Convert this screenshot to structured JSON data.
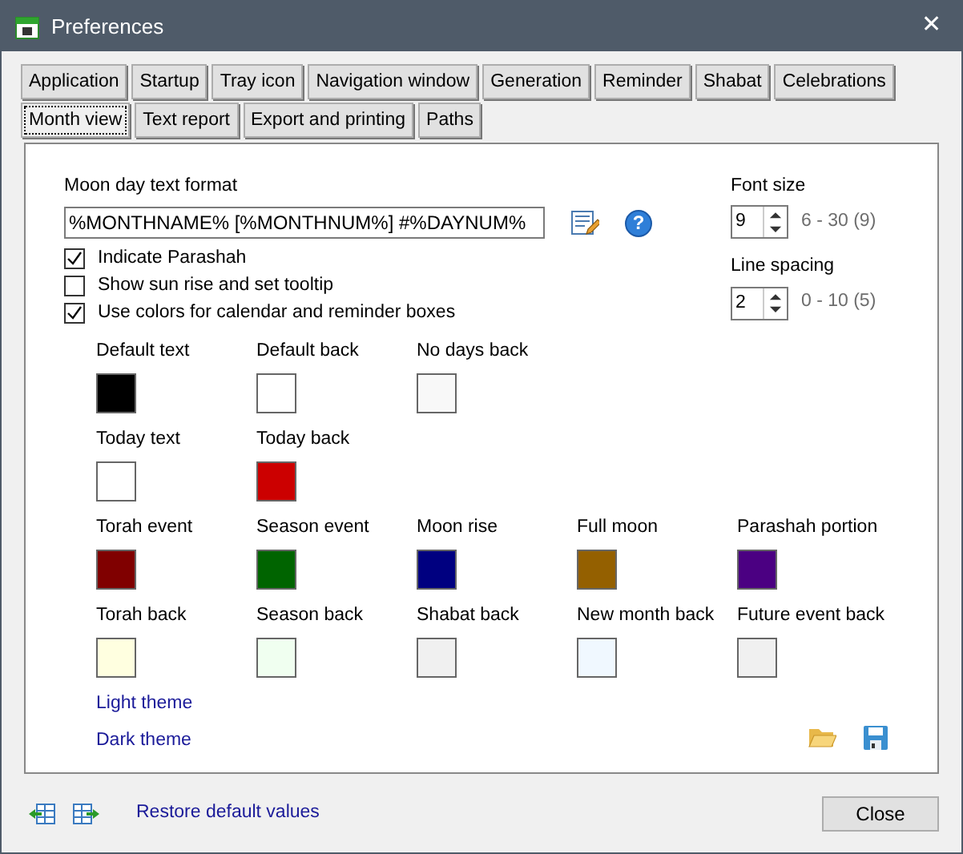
{
  "window": {
    "title": "Preferences",
    "close": "✕"
  },
  "tabs": [
    {
      "label": "Application",
      "selected": false
    },
    {
      "label": "Startup",
      "selected": false
    },
    {
      "label": "Tray icon",
      "selected": false
    },
    {
      "label": "Navigation window",
      "selected": false
    },
    {
      "label": "Generation",
      "selected": false
    },
    {
      "label": "Reminder",
      "selected": false
    },
    {
      "label": "Shabat",
      "selected": false
    },
    {
      "label": "Celebrations",
      "selected": false
    },
    {
      "label": "Month view",
      "selected": true
    },
    {
      "label": "Text report",
      "selected": false
    },
    {
      "label": "Export and printing",
      "selected": false
    },
    {
      "label": "Paths",
      "selected": false
    }
  ],
  "format": {
    "label": "Moon day text format",
    "value": "%MONTHNAME% [%MONTHNUM%] #%DAYNUM%",
    "help": "?"
  },
  "checkboxes": [
    {
      "label": "Indicate Parashah",
      "checked": true
    },
    {
      "label": "Show sun rise and set tooltip",
      "checked": false
    },
    {
      "label": "Use colors for calendar and reminder boxes",
      "checked": true
    }
  ],
  "spinners": [
    {
      "label": "Font size",
      "value": "9",
      "range": "6 - 30 (9)"
    },
    {
      "label": "Line spacing",
      "value": "2",
      "range": "0 - 10 (5)"
    }
  ],
  "color_rows": [
    [
      {
        "label": "Default text",
        "color": "#000000"
      },
      {
        "label": "Default back",
        "color": "#ffffff"
      },
      {
        "label": "No days back",
        "color": "#f8f8f8"
      }
    ],
    [
      {
        "label": "Today text",
        "color": "#ffffff"
      },
      {
        "label": "Today back",
        "color": "#cc0000"
      }
    ],
    [
      {
        "label": "Torah event",
        "color": "#800000"
      },
      {
        "label": "Season event",
        "color": "#006400"
      },
      {
        "label": "Moon rise",
        "color": "#000080"
      },
      {
        "label": "Full moon",
        "color": "#946000"
      },
      {
        "label": "Parashah portion",
        "color": "#4b0082"
      }
    ],
    [
      {
        "label": "Torah back",
        "color": "#ffffe0"
      },
      {
        "label": "Season back",
        "color": "#f0fff0"
      },
      {
        "label": "Shabat back",
        "color": "#f0f0f0"
      },
      {
        "label": "New month back",
        "color": "#f0f8ff"
      },
      {
        "label": "Future event back",
        "color": "#f0f0f0"
      }
    ]
  ],
  "themes": [
    "Light theme",
    "Dark theme"
  ],
  "footer": {
    "link": "Restore default values",
    "button": "Close"
  }
}
